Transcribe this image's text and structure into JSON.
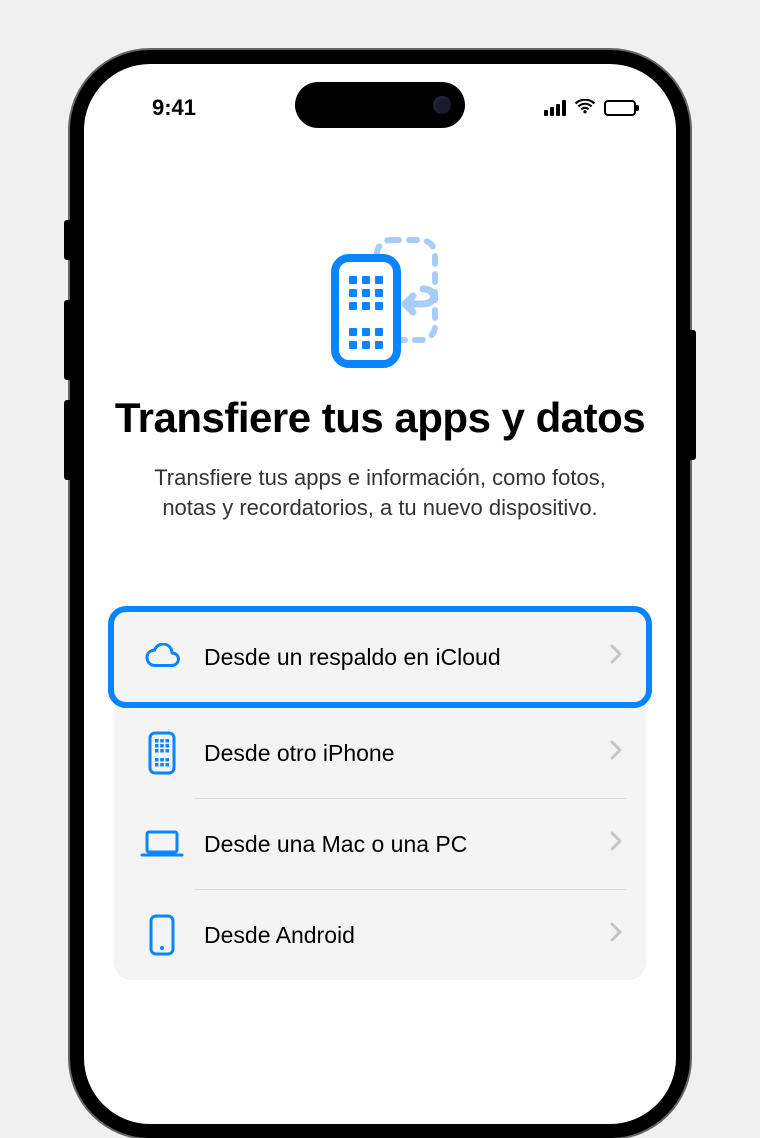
{
  "status": {
    "time": "9:41"
  },
  "hero": {
    "title": "Transfiere tus apps y datos",
    "subtitle": "Transfiere tus apps e información, como fotos, notas y recordatorios, a tu nuevo dispositivo."
  },
  "options": [
    {
      "icon": "cloud",
      "label": "Desde un respaldo en iCloud",
      "highlighted": true
    },
    {
      "icon": "iphone",
      "label": "Desde otro iPhone",
      "highlighted": false
    },
    {
      "icon": "laptop",
      "label": "Desde una Mac o una PC",
      "highlighted": false
    },
    {
      "icon": "phone-outline",
      "label": "Desde Android",
      "highlighted": false
    }
  ],
  "colors": {
    "accent": "#0a84ff",
    "accent_light": "#8fc3ff"
  }
}
